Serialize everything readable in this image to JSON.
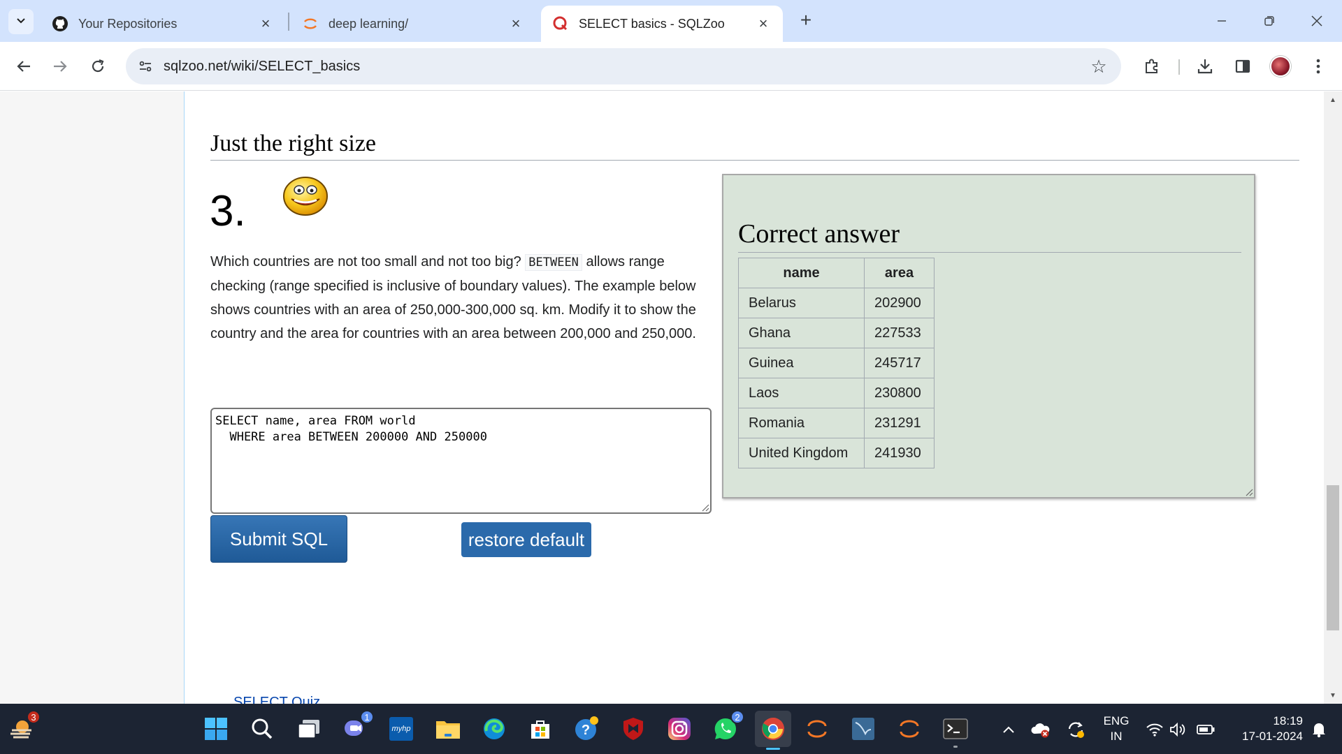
{
  "browser": {
    "tabs": [
      {
        "title": "Your Repositories",
        "favicon": "github-icon",
        "active": false
      },
      {
        "title": "deep learning/",
        "favicon": "jupyter-icon",
        "active": false
      },
      {
        "title": "SELECT basics - SQLZoo",
        "favicon": "sqlzoo-icon",
        "active": true
      }
    ],
    "url": "sqlzoo.net/wiki/SELECT_basics"
  },
  "page": {
    "section_heading": "Just the right size",
    "question_number": "3.",
    "description_part1": "Which countries are not too small and not too big? ",
    "description_code": "BETWEEN",
    "description_part2": " allows range checking (range specified is inclusive of boundary values). The example below shows countries with an area of 250,000-300,000 sq. km. Modify it to show the country and the area for countries with an area between 200,000 and 250,000.",
    "sql_query": "SELECT name, area FROM world\n  WHERE area BETWEEN 200000 AND 250000",
    "submit_label": "Submit SQL",
    "restore_label": "restore default",
    "next_link": "SELECT Quiz",
    "answer": {
      "title": "Correct answer",
      "columns": [
        "name",
        "area"
      ],
      "rows": [
        [
          "Belarus",
          "202900"
        ],
        [
          "Ghana",
          "227533"
        ],
        [
          "Guinea",
          "245717"
        ],
        [
          "Laos",
          "230800"
        ],
        [
          "Romania",
          "231291"
        ],
        [
          "United Kingdom",
          "241930"
        ]
      ]
    }
  },
  "taskbar": {
    "weather_badge": "3",
    "teams_badge": "1",
    "whatsapp_badge": "2",
    "hp_label": "myhp",
    "lang_line1": "ENG",
    "lang_line2": "IN",
    "time": "18:19",
    "date": "17-01-2024"
  },
  "colors": {
    "tab_strip": "#d3e3fd",
    "answer_bg": "#d9e4d9",
    "button_blue": "#2b6aab",
    "taskbar": "#1c2433"
  }
}
